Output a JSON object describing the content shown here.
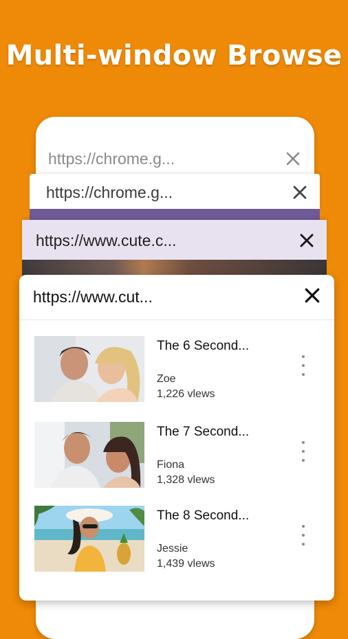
{
  "headline": "Multi-window Browse",
  "windows": [
    {
      "url": "https://chrome.g..."
    },
    {
      "url": "https://chrome.g..."
    },
    {
      "url": "https://www.cute.c..."
    },
    {
      "url": "https://www.cut..."
    }
  ],
  "videos": [
    {
      "title": "The 6 Second...",
      "author": "Zoe",
      "views": "1,226 vlews"
    },
    {
      "title": "The 7 Second...",
      "author": "Fiona",
      "views": "1,328 vlews"
    },
    {
      "title": "The 8 Second...",
      "author": "Jessie",
      "views": "1,439 vlews"
    }
  ],
  "icons": {
    "close": "close-icon",
    "more": "more-vert-icon"
  },
  "colors": {
    "background": "#EE8A07",
    "accent_purple": "#6E5A98"
  }
}
